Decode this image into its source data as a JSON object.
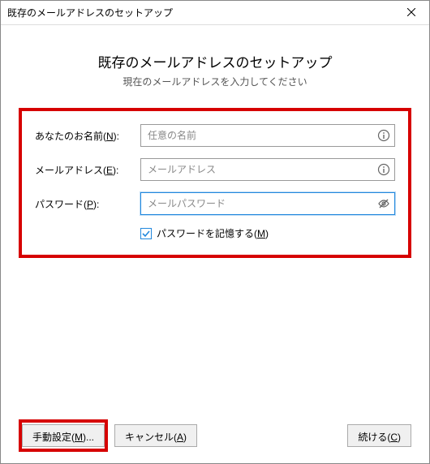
{
  "titlebar": {
    "title": "既存のメールアドレスのセットアップ"
  },
  "heading": "既存のメールアドレスのセットアップ",
  "subheading": "現在のメールアドレスを入力してください",
  "form": {
    "name": {
      "label_pre": "あなたのお名前(",
      "label_u": "N",
      "label_post": "):",
      "placeholder": "任意の名前",
      "value": ""
    },
    "email": {
      "label_pre": "メールアドレス(",
      "label_u": "E",
      "label_post": "):",
      "placeholder": "メールアドレス",
      "value": ""
    },
    "password": {
      "label_pre": "パスワード(",
      "label_u": "P",
      "label_post": "):",
      "placeholder": "メールパスワード",
      "value": ""
    },
    "remember": {
      "label_pre": "パスワードを記憶する(",
      "label_u": "M",
      "label_post": ")",
      "checked": true
    }
  },
  "buttons": {
    "manual_pre": "手動設定(",
    "manual_u": "M",
    "manual_post": ")...",
    "cancel_pre": "キャンセル(",
    "cancel_u": "A",
    "cancel_post": ")",
    "continue_pre": "続ける(",
    "continue_u": "C",
    "continue_post": ")"
  }
}
